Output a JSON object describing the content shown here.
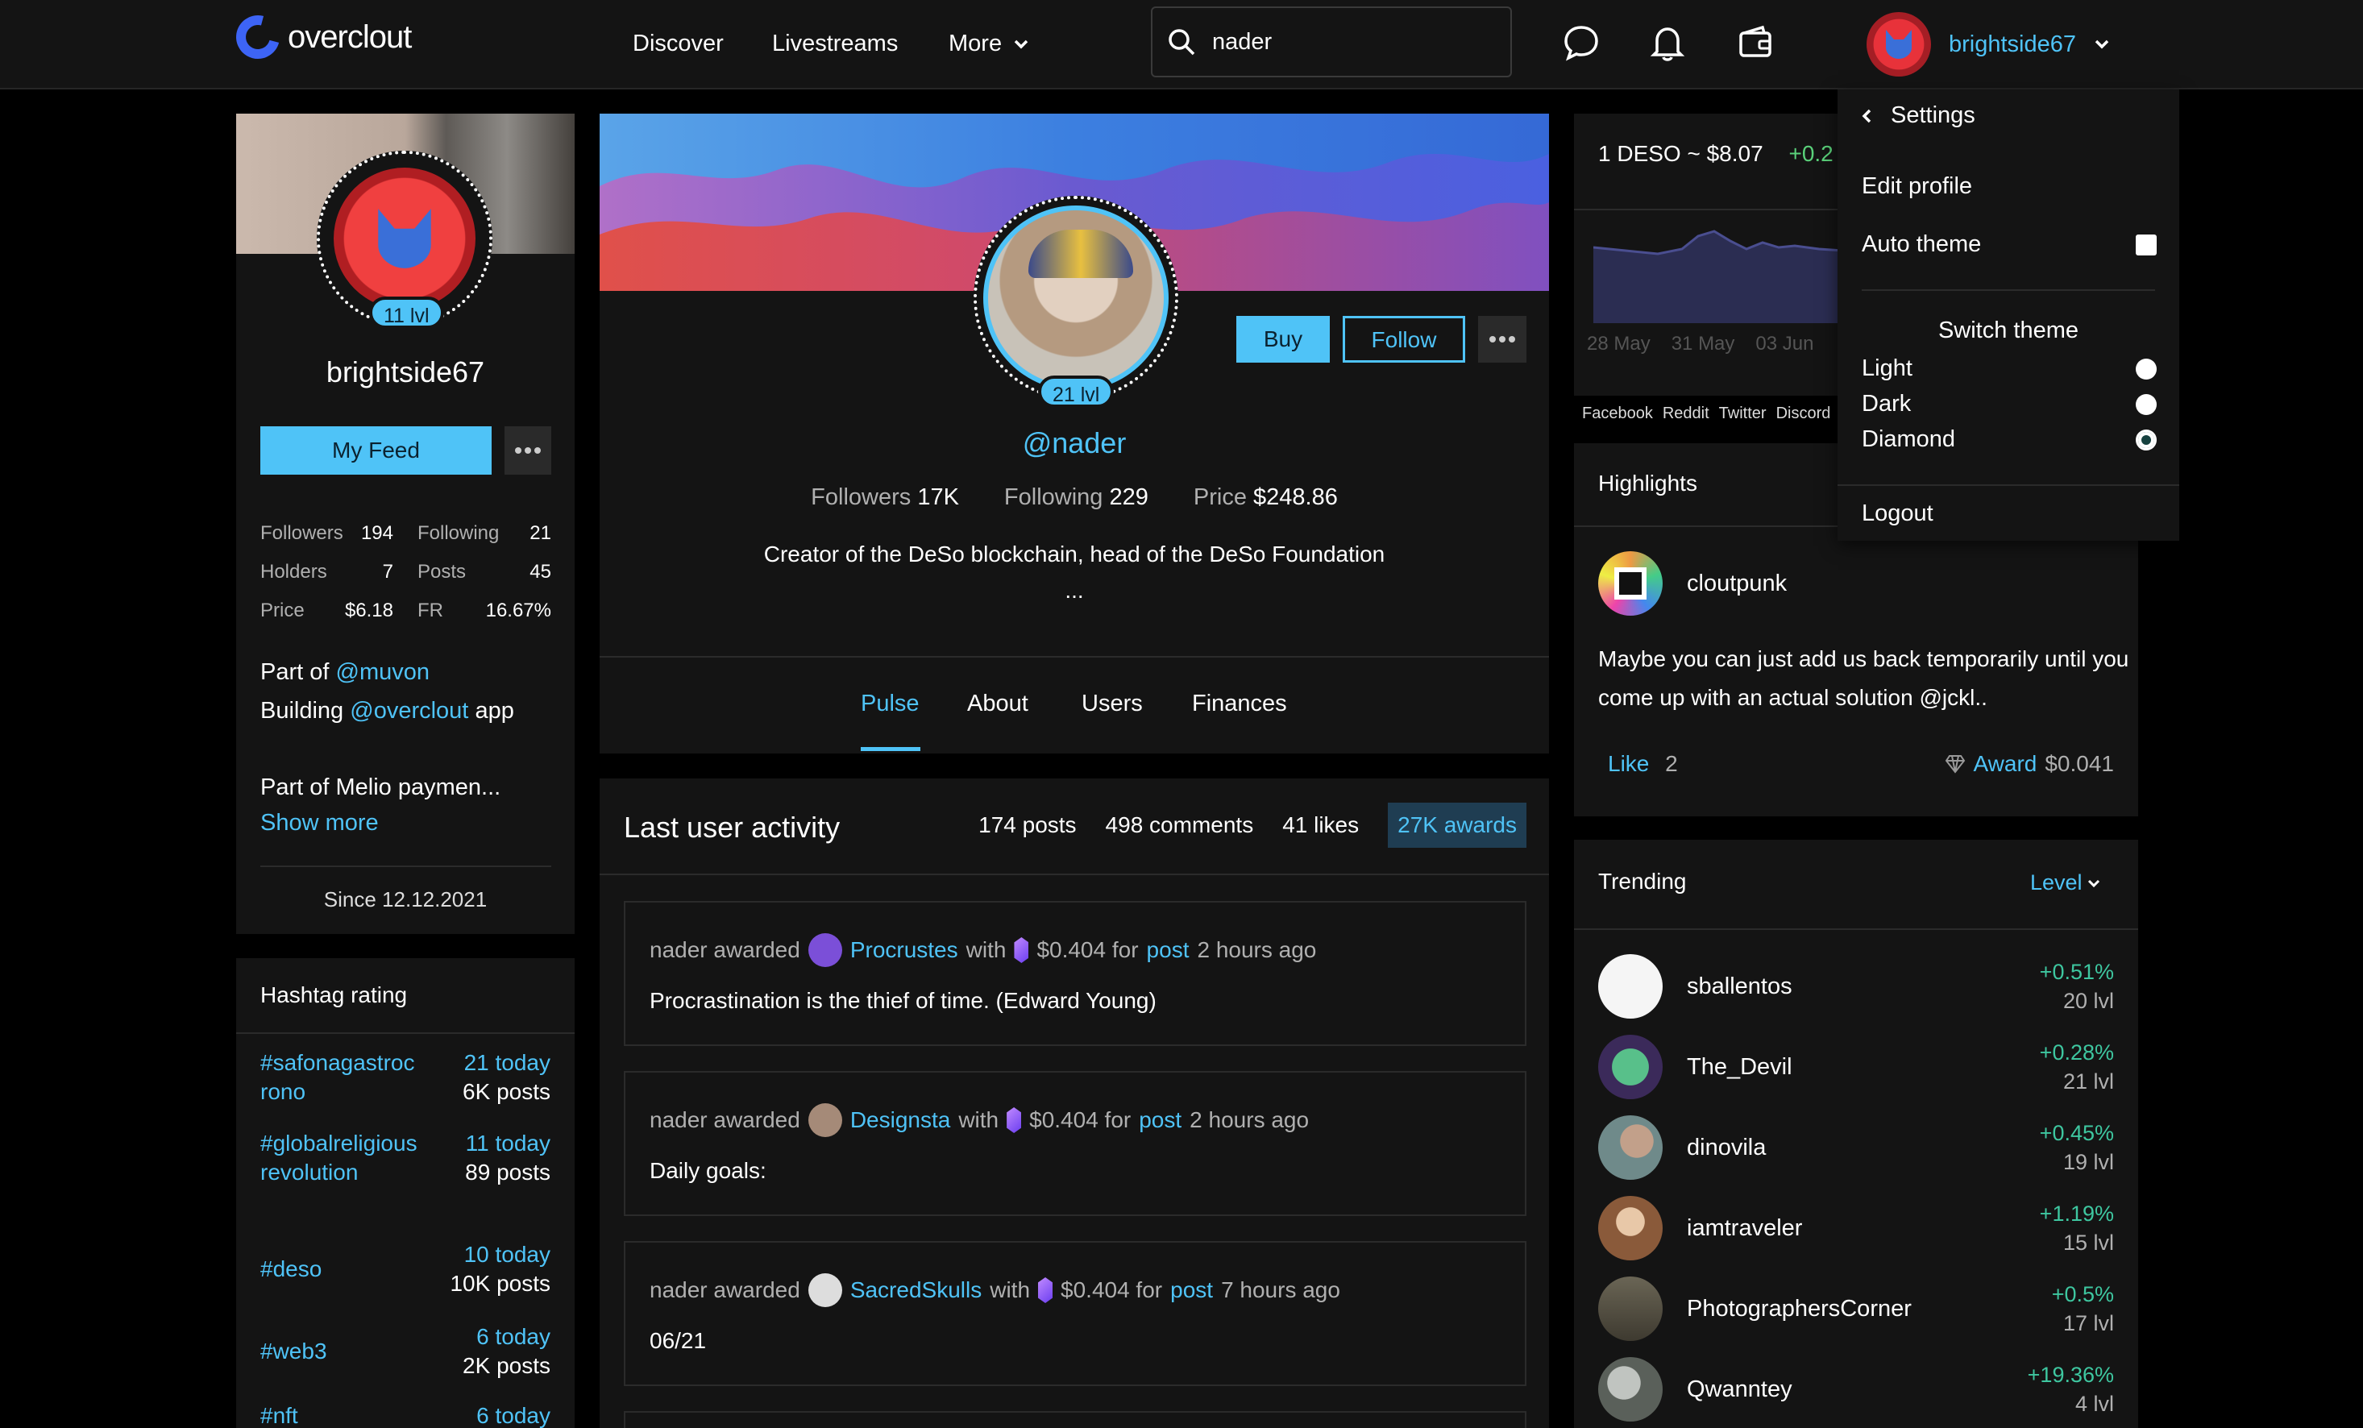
{
  "app": {
    "name": "overclout"
  },
  "nav": {
    "discover": "Discover",
    "livestreams": "Livestreams",
    "more": "More"
  },
  "search": {
    "value": "nader",
    "placeholder": ""
  },
  "user": {
    "username": "brightside67"
  },
  "left_profile": {
    "level": "11 lvl",
    "username": "brightside67",
    "my_feed": "My Feed",
    "stats": [
      {
        "label": "Followers",
        "value": "194"
      },
      {
        "label": "Following",
        "value": "21"
      },
      {
        "label": "Holders",
        "value": "7"
      },
      {
        "label": "Posts",
        "value": "45"
      },
      {
        "label": "Price",
        "value": "$6.18"
      },
      {
        "label": "FR",
        "value": "16.67%"
      }
    ],
    "bio_part_of": "Part of",
    "bio_part_of_link": "@muvon",
    "bio_building": "Building",
    "bio_building_link": "@overclout",
    "bio_building_suffix": "app",
    "bio_melio": "Part of Melio paymen...",
    "show_more": "Show more",
    "since": "Since 12.12.2021"
  },
  "hashtags": {
    "title": "Hashtag rating",
    "items": [
      {
        "tag": "#safonagastrocrono",
        "today": "21 today",
        "posts": "6K posts"
      },
      {
        "tag": "#globalreligiousrevolution",
        "today": "11 today",
        "posts": "89 posts"
      },
      {
        "tag": "#deso",
        "today": "10 today",
        "posts": "10K posts"
      },
      {
        "tag": "#web3",
        "today": "6 today",
        "posts": "2K posts"
      },
      {
        "tag": "#nft",
        "today": "6 today",
        "posts": ""
      }
    ]
  },
  "profile": {
    "level": "21 lvl",
    "handle": "@nader",
    "buy": "Buy",
    "follow": "Follow",
    "followers_label": "Followers",
    "followers": "17K",
    "following_label": "Following",
    "following": "229",
    "price_label": "Price",
    "price": "$248.86",
    "bio": "Creator of the DeSo blockchain, head of the DeSo Foundation",
    "ellipsis": "...",
    "tabs": [
      "Pulse",
      "About",
      "Users",
      "Finances"
    ]
  },
  "activity": {
    "title": "Last user activity",
    "counts": [
      "174 posts",
      "498 comments",
      "41 likes",
      "27K awards"
    ],
    "items": [
      {
        "actor": "nader awarded",
        "user": "Procrustes",
        "with": "with",
        "amount": "$0.404 for",
        "link": "post",
        "time": "2 hours ago",
        "text": "Procrastination is the thief of time. (Edward Young)"
      },
      {
        "actor": "nader awarded",
        "user": "Designsta",
        "with": "with",
        "amount": "$0.404 for",
        "link": "post",
        "time": "2 hours ago",
        "text": "Daily goals:"
      },
      {
        "actor": "nader awarded",
        "user": "SacredSkulls",
        "with": "with",
        "amount": "$0.404 for",
        "link": "post",
        "time": "7 hours ago",
        "text": "06/21"
      }
    ]
  },
  "price_widget": {
    "label": "1 DESO ~ $8.07",
    "change": "+0.2",
    "dates": [
      "28 May",
      "31 May",
      "03 Jun"
    ],
    "chart_color": "#2b2d52"
  },
  "footer_links": [
    "Facebook",
    "Reddit",
    "Twitter",
    "Discord"
  ],
  "highlights": {
    "title": "Highlights",
    "user": "cloutpunk",
    "text": "Maybe you can just add us back temporarily until you come up with an actual solution @jckl..",
    "like": "Like",
    "like_count": "2",
    "award": "Award",
    "award_value": "$0.041"
  },
  "trending": {
    "title": "Trending",
    "filter": "Level",
    "items": [
      {
        "name": "sballentos",
        "pct": "+0.51%",
        "lvl": "20 lvl",
        "color": "#f5f5f5"
      },
      {
        "name": "The_Devil",
        "pct": "+0.28%",
        "lvl": "21 lvl",
        "color": "#3b7a66"
      },
      {
        "name": "dinovila",
        "pct": "+0.45%",
        "lvl": "19 lvl",
        "color": "#8a9a9a"
      },
      {
        "name": "iamtraveler",
        "pct": "+1.19%",
        "lvl": "15 lvl",
        "color": "#9a7a60"
      },
      {
        "name": "PhotographersCorner",
        "pct": "+0.5%",
        "lvl": "17 lvl",
        "color": "#5a5548"
      },
      {
        "name": "Qwanntey",
        "pct": "+19.36%",
        "lvl": "4 lvl",
        "color": "#6f7570"
      }
    ]
  },
  "settings_menu": {
    "title": "Settings",
    "edit_profile": "Edit profile",
    "auto_theme": "Auto theme",
    "switch_theme": "Switch theme",
    "themes": [
      "Light",
      "Dark",
      "Diamond"
    ],
    "selected_theme": "Diamond",
    "logout": "Logout"
  },
  "colors": {
    "accent": "#4fc3f7",
    "positive": "#3ec7a0",
    "background": "#000000",
    "panel": "#141414"
  }
}
